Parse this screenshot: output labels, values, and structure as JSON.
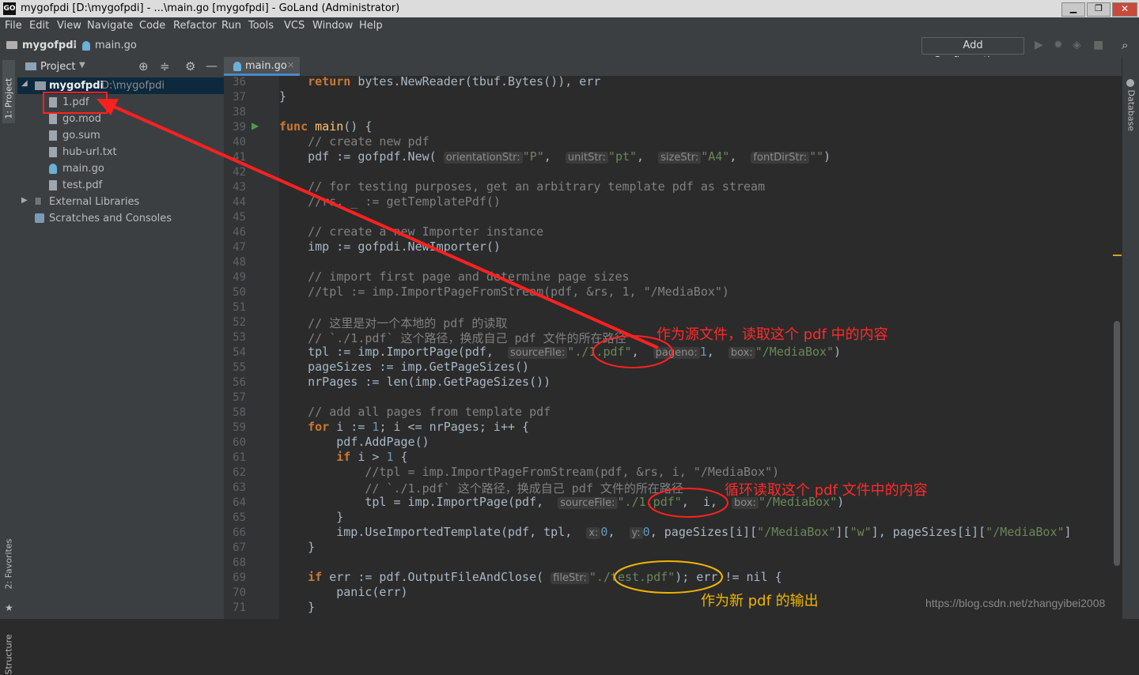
{
  "window": {
    "title": "mygofpdi [D:\\mygofpdi] - ...\\main.go [mygofpdi] - GoLand (Administrator)",
    "app_icon": "GO"
  },
  "menu": [
    "File",
    "Edit",
    "View",
    "Navigate",
    "Code",
    "Refactor",
    "Run",
    "Tools",
    "VCS",
    "Window",
    "Help"
  ],
  "breadcrumb": {
    "project": "mygofpdi",
    "file": "main.go"
  },
  "toolbar": {
    "add_config": "Add Configuration..."
  },
  "left_tools": {
    "project": "1: Project",
    "favorites": "2: Favorites",
    "structure": "Structure"
  },
  "right_tools": {
    "database": "Database"
  },
  "project_panel": {
    "title": "Project",
    "root": {
      "name": "mygofpdi",
      "path": "D:\\mygofpdi"
    },
    "files": [
      "1.pdf",
      "go.mod",
      "go.sum",
      "hub-url.txt",
      "main.go",
      "test.pdf"
    ],
    "external": "External Libraries",
    "scratches": "Scratches and Consoles"
  },
  "editor": {
    "tab": "main.go",
    "line_numbers": [
      "36",
      "37",
      "38",
      "39",
      "40",
      "41",
      "42",
      "43",
      "44",
      "45",
      "46",
      "47",
      "48",
      "49",
      "50",
      "51",
      "52",
      "53",
      "54",
      "55",
      "56",
      "57",
      "58",
      "59",
      "60",
      "61",
      "62",
      "63",
      "64",
      "65",
      "66",
      "67",
      "68",
      "69",
      "70",
      "71"
    ],
    "hints": {
      "orientationStr": "orientationStr:",
      "unitStr": "unitStr:",
      "sizeStr": "sizeStr:",
      "fontDirStr": "fontDirStr:",
      "sourceFile": "sourceFile:",
      "pageno": "pageno:",
      "box": "box:",
      "x": "x:",
      "y": "y:",
      "fileStr": "fileStr:"
    }
  },
  "annotations": {
    "a1": "作为源文件，读取这个 pdf 中的内容",
    "a2": "循环读取这个 pdf 文件中的内容",
    "a3": "作为新 pdf 的输出"
  },
  "watermark": "https://blog.csdn.net/zhangyibei2008",
  "colors": {
    "annotation": "#ff2a2a",
    "ellipse_orange": "#f0b400"
  }
}
